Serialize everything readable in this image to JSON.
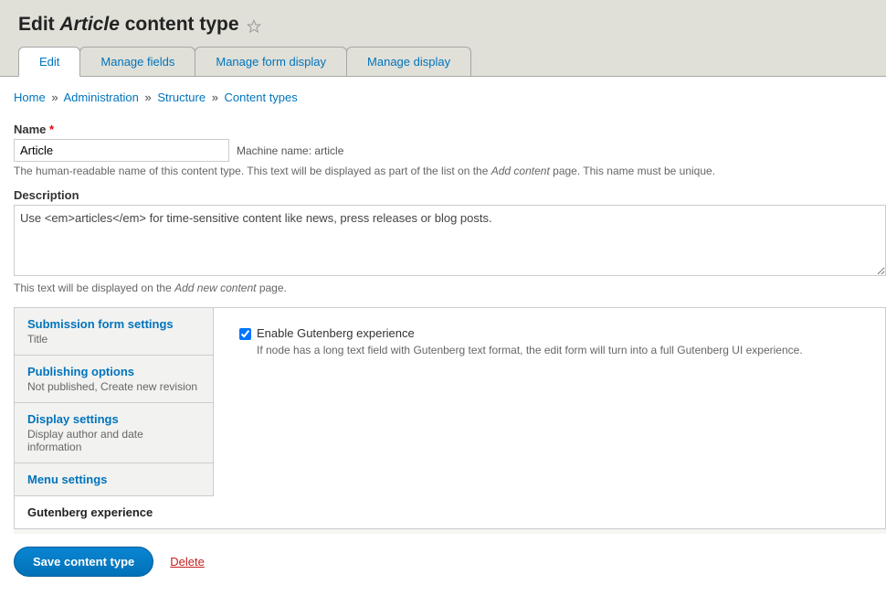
{
  "page": {
    "title_prefix": "Edit",
    "title_em": "Article",
    "title_suffix": "content type"
  },
  "tabs": {
    "edit": "Edit",
    "manage_fields": "Manage fields",
    "manage_form_display": "Manage form display",
    "manage_display": "Manage display"
  },
  "breadcrumb": {
    "home": "Home",
    "administration": "Administration",
    "structure": "Structure",
    "content_types": "Content types"
  },
  "form": {
    "name_label": "Name",
    "name_value": "Article",
    "machine_name_prefix": "Machine name:",
    "machine_name_value": "article",
    "name_help_1": "The human-readable name of this content type. This text will be displayed as part of the list on the ",
    "name_help_em": "Add content",
    "name_help_2": " page. This name must be unique.",
    "description_label": "Description",
    "description_value": "Use <em>articles</em> for time-sensitive content like news, press releases or blog posts.",
    "description_help_1": "This text will be displayed on the ",
    "description_help_em": "Add new content",
    "description_help_2": " page."
  },
  "vtabs": {
    "submission": {
      "title": "Submission form settings",
      "summary": "Title"
    },
    "publishing": {
      "title": "Publishing options",
      "summary": "Not published, Create new revision"
    },
    "display": {
      "title": "Display settings",
      "summary": "Display author and date information"
    },
    "menu": {
      "title": "Menu settings"
    },
    "gutenberg": {
      "title": "Gutenberg experience"
    }
  },
  "panel": {
    "checkbox_label": "Enable Gutenberg experience",
    "checkbox_desc": "If node has a long text field with Gutenberg text format, the edit form will turn into a full Gutenberg UI experience."
  },
  "actions": {
    "save": "Save content type",
    "delete": "Delete"
  }
}
